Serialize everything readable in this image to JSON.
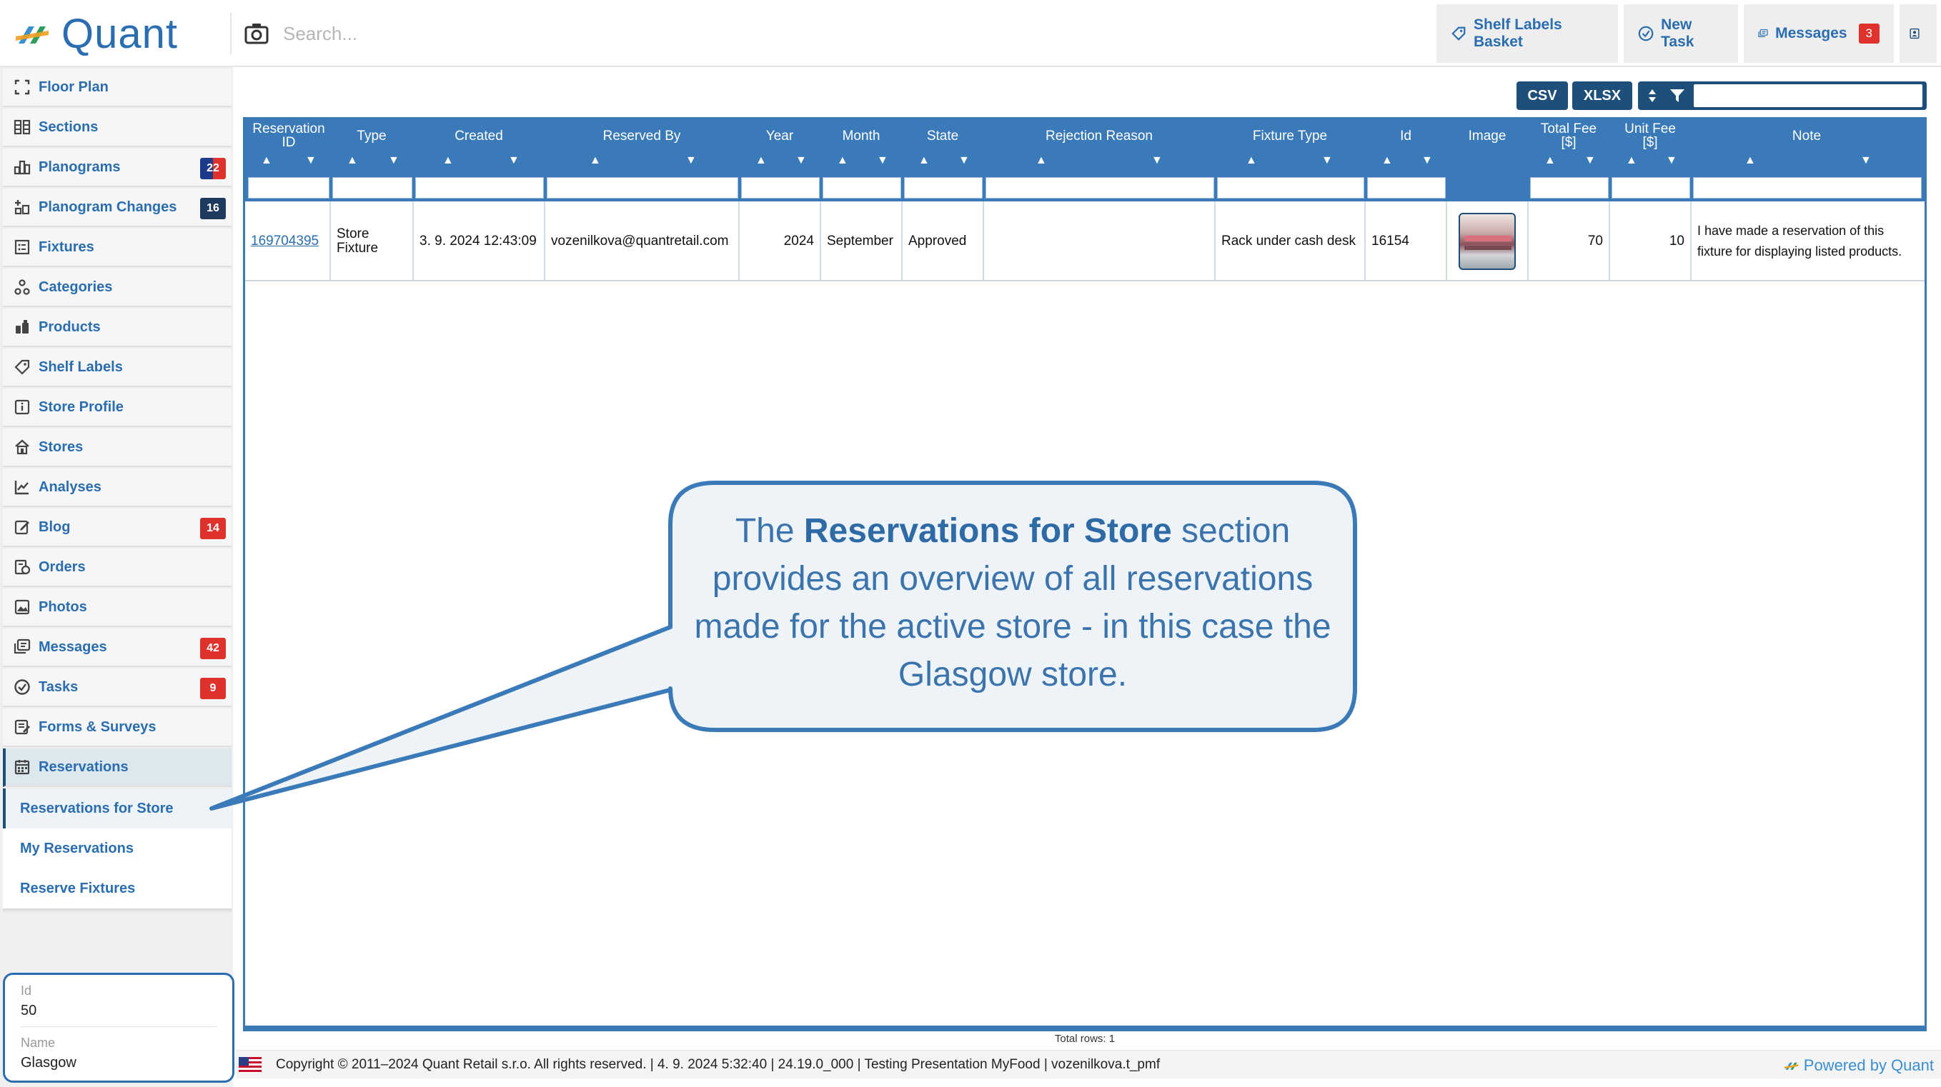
{
  "app": {
    "logo_text": "Quant"
  },
  "search": {
    "placeholder": "Search..."
  },
  "header_buttons": {
    "shelf_labels_basket": "Shelf Labels Basket",
    "new_task": "New Task",
    "messages": "Messages",
    "messages_count": "3"
  },
  "sidebar": {
    "items": [
      {
        "label": "Floor Plan",
        "icon": "floor-plan-icon"
      },
      {
        "label": "Sections",
        "icon": "sections-icon"
      },
      {
        "label": "Planograms",
        "icon": "planograms-icon",
        "badge": "22"
      },
      {
        "label": "Planogram Changes",
        "icon": "planogram-changes-icon",
        "badge": "16"
      },
      {
        "label": "Fixtures",
        "icon": "fixtures-icon"
      },
      {
        "label": "Categories",
        "icon": "categories-icon"
      },
      {
        "label": "Products",
        "icon": "products-icon"
      },
      {
        "label": "Shelf Labels",
        "icon": "tag-icon"
      },
      {
        "label": "Store Profile",
        "icon": "info-icon"
      },
      {
        "label": "Stores",
        "icon": "stores-icon"
      },
      {
        "label": "Analyses",
        "icon": "analyses-icon"
      },
      {
        "label": "Blog",
        "icon": "blog-icon",
        "badge": "14"
      },
      {
        "label": "Orders",
        "icon": "orders-icon"
      },
      {
        "label": "Photos",
        "icon": "photos-icon"
      },
      {
        "label": "Messages",
        "icon": "messages-icon",
        "badge": "42"
      },
      {
        "label": "Tasks",
        "icon": "tasks-icon",
        "badge": "9"
      },
      {
        "label": "Forms & Surveys",
        "icon": "forms-icon"
      },
      {
        "label": "Reservations",
        "icon": "calendar-icon"
      }
    ],
    "subitems": [
      {
        "label": "Reservations for Store"
      },
      {
        "label": "My Reservations"
      },
      {
        "label": "Reserve Fixtures"
      }
    ],
    "store": {
      "id_label": "Id",
      "id_value": "50",
      "name_label": "Name",
      "name_value": "Glasgow"
    }
  },
  "toolbar": {
    "csv": "CSV",
    "xlsx": "XLSX"
  },
  "table": {
    "columns": [
      {
        "title": "Reservation\nID"
      },
      {
        "title": "Type"
      },
      {
        "title": "Created"
      },
      {
        "title": "Reserved By"
      },
      {
        "title": "Year"
      },
      {
        "title": "Month"
      },
      {
        "title": "State"
      },
      {
        "title": "Rejection Reason"
      },
      {
        "title": "Fixture Type"
      },
      {
        "title": "Id"
      },
      {
        "title": "Image"
      },
      {
        "title": "Total Fee\n[$]"
      },
      {
        "title": "Unit Fee\n[$]"
      },
      {
        "title": "Note"
      }
    ],
    "rows": [
      {
        "reservation_id": "169704395",
        "type": "Store\nFixture",
        "created": "3. 9. 2024 12:43:09",
        "reserved_by": "vozenilkova@quantretail.com",
        "year": "2024",
        "month": "September",
        "state": "Approved",
        "rejection_reason": "",
        "fixture_type": "Rack under cash desk",
        "id": "16154",
        "total_fee": "70",
        "unit_fee": "10",
        "note": "I have made a reservation of this fixture for displaying listed products."
      }
    ],
    "total_rows": "Total rows: 1"
  },
  "footer": {
    "copyright": "Copyright © 2011–2024 Quant Retail s.r.o. All rights reserved. | 4. 9. 2024 5:32:40 | 24.19.0_000 | Testing Presentation MyFood | vozenilkova.t_pmf",
    "powered_by": "Powered by Quant"
  },
  "callout": {
    "part1": "The ",
    "bold": "Reservations for Store",
    "part2": " section provides an overview of all reservations made for the active store - in this case the Glasgow store."
  }
}
